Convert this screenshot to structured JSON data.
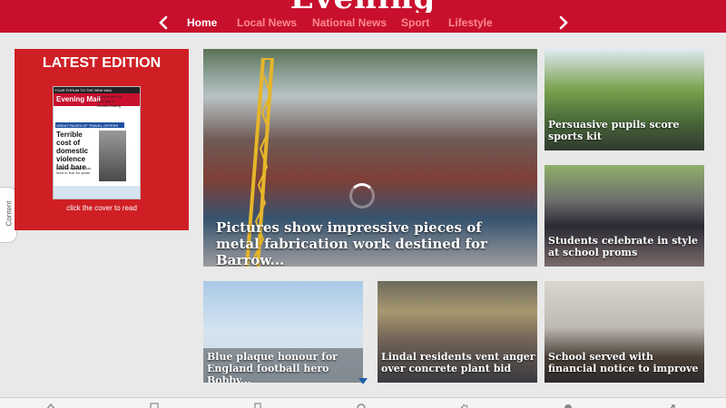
{
  "app": {
    "logo": "Evening Mail"
  },
  "nav": {
    "tabs": [
      {
        "label": "Home",
        "active": true
      },
      {
        "label": "Local News",
        "active": false
      },
      {
        "label": "National News",
        "active": false
      },
      {
        "label": "Sport",
        "active": false
      },
      {
        "label": "Lifestyle",
        "active": false
      }
    ]
  },
  "side_tab": {
    "label": "Content"
  },
  "latest_edition": {
    "heading": "LATEST EDITION",
    "caption": "click the cover to read",
    "cover": {
      "strap": "YOUR FORUM TO THE NEW MAIL",
      "masthead": "Evening Mail",
      "promo": "Crowds flock to final day of Kendal Calling",
      "bar": "GREAT PAGES OF TRAVEL OFFERS",
      "headline": "Terrible cost of domestic violence laid bare",
      "sub": "Mum-of-two Ruth has lived in fear for years"
    }
  },
  "stories": {
    "main": {
      "title": "Pictures show impressive pieces of metal fabrication work destined for Barrow..."
    },
    "right_top": {
      "title": "Persuasive pupils score sports kit"
    },
    "right_mid": {
      "title": "Students celebrate in style at school proms"
    },
    "bottom_1": {
      "title": "Blue plaque honour for England football hero Bobby..."
    },
    "bottom_2": {
      "title": "Lindal residents vent anger over concrete plant bid"
    },
    "bottom_3": {
      "title": "School served with financial notice to improve"
    }
  },
  "colors": {
    "brand": "#c8102e",
    "panel": "#cf1f25",
    "background": "#e9e9e9"
  }
}
